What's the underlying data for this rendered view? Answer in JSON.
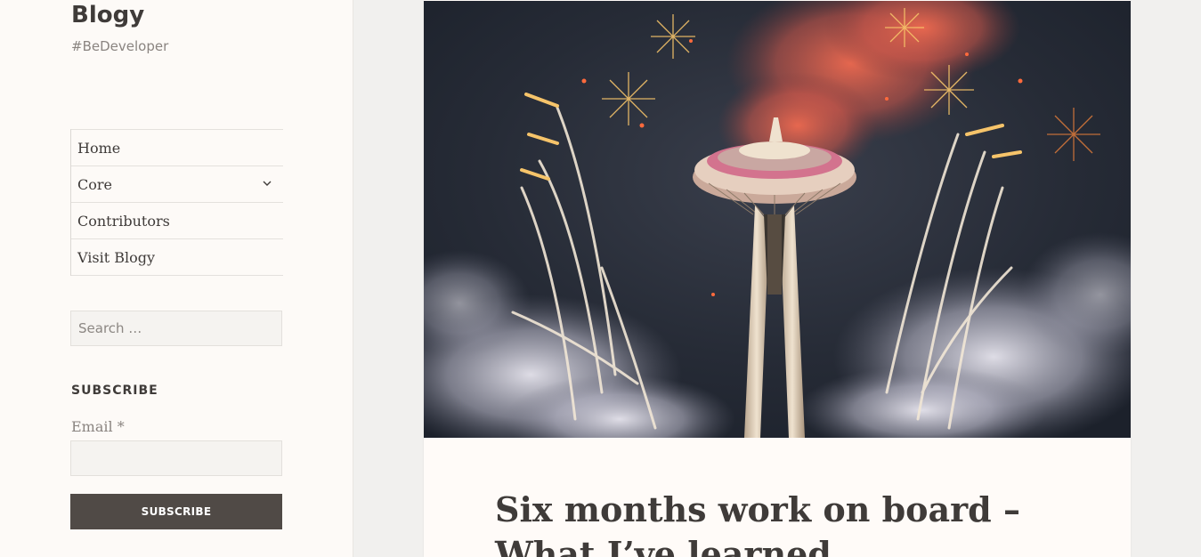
{
  "site": {
    "title": "Blogy",
    "tagline": "#BeDeveloper"
  },
  "nav": {
    "items": [
      {
        "label": "Home"
      },
      {
        "label": "Core"
      },
      {
        "label": "Contributors"
      },
      {
        "label": "Visit Blogy"
      }
    ],
    "expand_icon": "chevron-down-icon"
  },
  "search": {
    "placeholder": "Search …"
  },
  "subscribe": {
    "heading": "SUBSCRIBE",
    "email_label": "Email *",
    "email_value": "",
    "button_label": "SUBSCRIBE"
  },
  "post": {
    "title": "Six months work on board – What I’ve learned"
  },
  "colors": {
    "sidebar_bg": "#fdfaf7",
    "page_bg": "#f1f0ee",
    "text": "#3f3b39",
    "muted": "#8a8480",
    "button_bg": "#504a46"
  }
}
